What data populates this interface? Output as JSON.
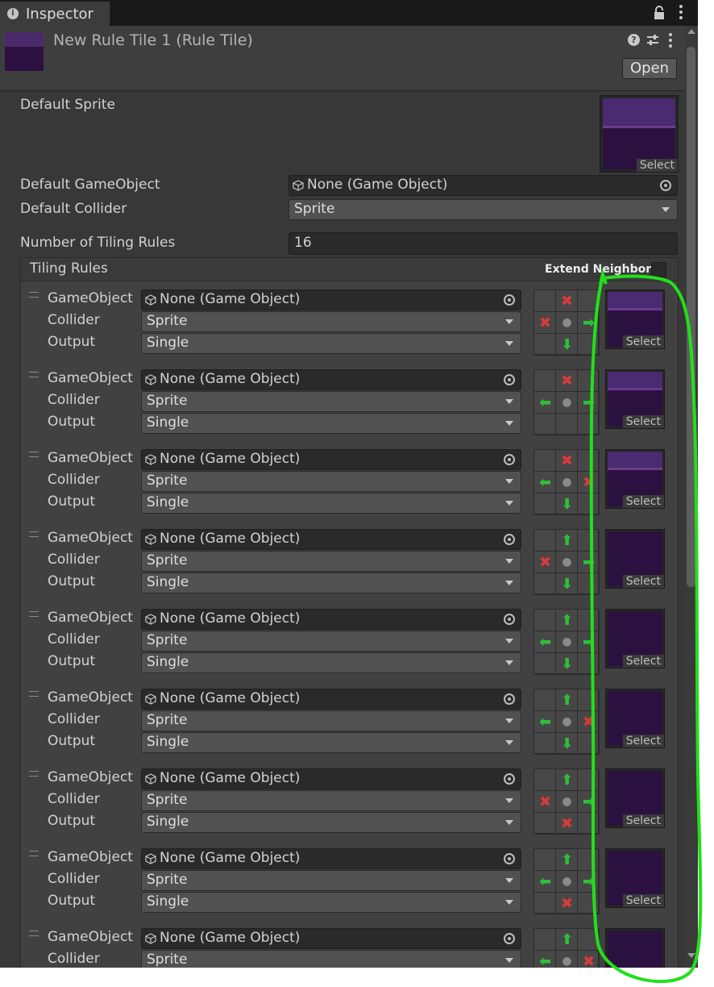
{
  "tab": {
    "icon": "info-icon",
    "title": "Inspector"
  },
  "header": {
    "title": "New Rule Tile 1 (Rule Tile)",
    "open_label": "Open",
    "icons": [
      "help-icon",
      "preset-icon",
      "more-icon"
    ]
  },
  "fields": {
    "default_sprite_label": "Default Sprite",
    "select_label": "Select",
    "default_gameobject_label": "Default GameObject",
    "default_gameobject_value": "None (Game Object)",
    "default_collider_label": "Default Collider",
    "default_collider_value": "Sprite",
    "num_rules_label": "Number of Tiling Rules",
    "num_rules_value": "16"
  },
  "tiling_rules": {
    "title": "Tiling Rules",
    "extend_neighbor_label": "Extend Neighbor",
    "extend_neighbor_checked": false,
    "row_labels": {
      "gameobject": "GameObject",
      "collider": "Collider",
      "output": "Output"
    },
    "gameobject_value": "None (Game Object)",
    "collider_value": "Sprite",
    "output_value": "Single",
    "select_label": "Select",
    "rules": [
      {
        "grid": [
          "",
          "x",
          "",
          "x",
          "o",
          "right",
          "",
          "down",
          ""
        ],
        "sprite": "top"
      },
      {
        "grid": [
          "",
          "x",
          "",
          "left",
          "o",
          "right",
          "",
          "",
          ""
        ],
        "sprite": "top"
      },
      {
        "grid": [
          "",
          "x",
          "",
          "left",
          "o",
          "x",
          "",
          "down",
          ""
        ],
        "sprite": "top-corner"
      },
      {
        "grid": [
          "",
          "up",
          "",
          "x",
          "o",
          "right",
          "",
          "down",
          ""
        ],
        "sprite": "fill"
      },
      {
        "grid": [
          "",
          "up",
          "",
          "left",
          "o",
          "right",
          "",
          "down",
          ""
        ],
        "sprite": "fill"
      },
      {
        "grid": [
          "",
          "up",
          "",
          "left",
          "o",
          "x",
          "",
          "down",
          ""
        ],
        "sprite": "fill"
      },
      {
        "grid": [
          "",
          "up",
          "",
          "x",
          "o",
          "right",
          "",
          "x",
          ""
        ],
        "sprite": "fill-corner"
      },
      {
        "grid": [
          "",
          "up",
          "",
          "left",
          "o",
          "right",
          "",
          "x",
          ""
        ],
        "sprite": "fill"
      },
      {
        "grid": [
          "",
          "up",
          "",
          "left",
          "o",
          "x",
          "",
          "",
          ""
        ],
        "sprite": "fill"
      }
    ]
  },
  "colors": {
    "accent_green": "#22e01a",
    "deny_red": "#d83a3a",
    "allow_green": "#2fbf3a"
  }
}
